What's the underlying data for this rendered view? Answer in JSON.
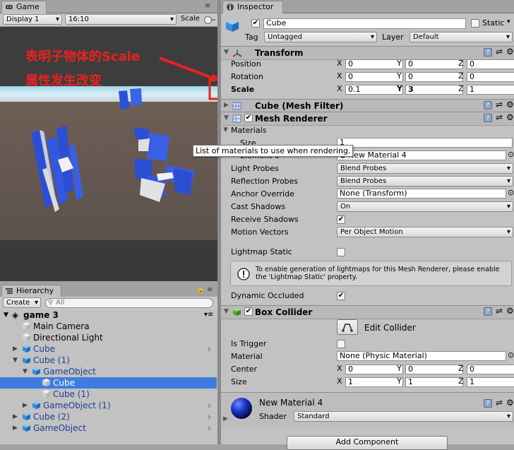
{
  "game": {
    "tab_label": "Game",
    "display": "Display 1",
    "aspect": "16:10",
    "scale_label": "Scale"
  },
  "annotation": {
    "line1": "表明子物体的Scale",
    "line2": "属性发生改变",
    "color": "#e8221f"
  },
  "hierarchy": {
    "tab_label": "Hierarchy",
    "create_label": "Create",
    "search_placeholder": "All",
    "scene_name": "game 3",
    "items": [
      {
        "label": "Main Camera",
        "color": "#000000"
      },
      {
        "label": "Directional Light",
        "color": "#000000"
      },
      {
        "label": "Cube",
        "color": "#1c3f91"
      },
      {
        "label": "Cube (1)",
        "color": "#1c3f91"
      },
      {
        "label": "GameObject",
        "color": "#1c3f91"
      },
      {
        "label": "Cube",
        "color": "#ffffff"
      },
      {
        "label": "Cube (1)",
        "color": "#1c3f91"
      },
      {
        "label": "GameObject (1)",
        "color": "#1c3f91"
      },
      {
        "label": "Cube (2)",
        "color": "#1c3f91"
      },
      {
        "label": "GameObject",
        "color": "#1c3f91"
      }
    ]
  },
  "inspector": {
    "tab_label": "Inspector",
    "object_name": "Cube",
    "static_label": "Static",
    "tag_label": "Tag",
    "tag_value": "Untagged",
    "layer_label": "Layer",
    "layer_value": "Default",
    "transform": {
      "title": "Transform",
      "position_label": "Position",
      "rotation_label": "Rotation",
      "scale_label": "Scale",
      "position": {
        "x": "0",
        "y": "0",
        "z": "0"
      },
      "rotation": {
        "x": "0",
        "y": "0",
        "z": "0"
      },
      "scale": {
        "x": "0.1",
        "y": "3",
        "z": "1"
      }
    },
    "mesh_filter": {
      "title": "Cube (Mesh Filter)"
    },
    "mesh_renderer": {
      "title": "Mesh Renderer",
      "materials_label": "Materials",
      "size_label": "Size",
      "size_value": "1",
      "element_label": "Element 0",
      "element_value": "New Material 4",
      "tooltip": "List of materials to use when rendering.",
      "light_probes_label": "Light Probes",
      "light_probes_value": "Blend Probes",
      "reflection_probes_label": "Reflection Probes",
      "reflection_probes_value": "Blend Probes",
      "anchor_override_label": "Anchor Override",
      "anchor_override_value": "None (Transform)",
      "cast_shadows_label": "Cast Shadows",
      "cast_shadows_value": "On",
      "receive_shadows_label": "Receive Shadows",
      "motion_vectors_label": "Motion Vectors",
      "motion_vectors_value": "Per Object Motion",
      "lightmap_static_label": "Lightmap Static",
      "info_text": "To enable generation of lightmaps for this Mesh Renderer, please enable the 'Lightmap Static' property.",
      "dynamic_occluded_label": "Dynamic Occluded"
    },
    "box_collider": {
      "title": "Box Collider",
      "edit_collider_label": "Edit Collider",
      "is_trigger_label": "Is Trigger",
      "material_label": "Material",
      "material_value": "None (Physic Material)",
      "center_label": "Center",
      "size_label": "Size",
      "center": {
        "x": "0",
        "y": "0",
        "z": "0"
      },
      "size": {
        "x": "1",
        "y": "1",
        "z": "1"
      }
    },
    "material": {
      "name": "New Material 4",
      "shader_label": "Shader",
      "shader_value": "Standard"
    },
    "add_component_label": "Add Component"
  }
}
